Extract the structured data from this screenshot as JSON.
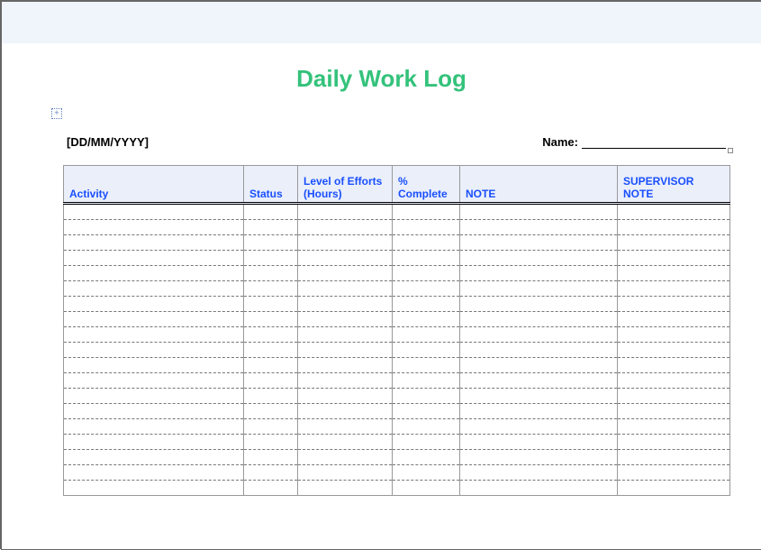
{
  "title": "Daily Work Log",
  "meta": {
    "date_placeholder": "[DD/MM/YYYY]",
    "name_label": "Name:",
    "name_value": ""
  },
  "columns": {
    "activity": "Activity",
    "status": "Status",
    "effort": "Level of Efforts (Hours)",
    "complete": "% Complete",
    "note": "NOTE",
    "supnote": "SUPERVISOR NOTE"
  },
  "rows": [
    {
      "activity": "",
      "status": "",
      "effort": "",
      "complete": "",
      "note": "",
      "supnote": ""
    },
    {
      "activity": "",
      "status": "",
      "effort": "",
      "complete": "",
      "note": "",
      "supnote": ""
    },
    {
      "activity": "",
      "status": "",
      "effort": "",
      "complete": "",
      "note": "",
      "supnote": ""
    },
    {
      "activity": "",
      "status": "",
      "effort": "",
      "complete": "",
      "note": "",
      "supnote": ""
    },
    {
      "activity": "",
      "status": "",
      "effort": "",
      "complete": "",
      "note": "",
      "supnote": ""
    },
    {
      "activity": "",
      "status": "",
      "effort": "",
      "complete": "",
      "note": "",
      "supnote": ""
    },
    {
      "activity": "",
      "status": "",
      "effort": "",
      "complete": "",
      "note": "",
      "supnote": ""
    },
    {
      "activity": "",
      "status": "",
      "effort": "",
      "complete": "",
      "note": "",
      "supnote": ""
    },
    {
      "activity": "",
      "status": "",
      "effort": "",
      "complete": "",
      "note": "",
      "supnote": ""
    },
    {
      "activity": "",
      "status": "",
      "effort": "",
      "complete": "",
      "note": "",
      "supnote": ""
    },
    {
      "activity": "",
      "status": "",
      "effort": "",
      "complete": "",
      "note": "",
      "supnote": ""
    },
    {
      "activity": "",
      "status": "",
      "effort": "",
      "complete": "",
      "note": "",
      "supnote": ""
    },
    {
      "activity": "",
      "status": "",
      "effort": "",
      "complete": "",
      "note": "",
      "supnote": ""
    },
    {
      "activity": "",
      "status": "",
      "effort": "",
      "complete": "",
      "note": "",
      "supnote": ""
    },
    {
      "activity": "",
      "status": "",
      "effort": "",
      "complete": "",
      "note": "",
      "supnote": ""
    },
    {
      "activity": "",
      "status": "",
      "effort": "",
      "complete": "",
      "note": "",
      "supnote": ""
    },
    {
      "activity": "",
      "status": "",
      "effort": "",
      "complete": "",
      "note": "",
      "supnote": ""
    },
    {
      "activity": "",
      "status": "",
      "effort": "",
      "complete": "",
      "note": "",
      "supnote": ""
    },
    {
      "activity": "",
      "status": "",
      "effort": "",
      "complete": "",
      "note": "",
      "supnote": ""
    }
  ]
}
